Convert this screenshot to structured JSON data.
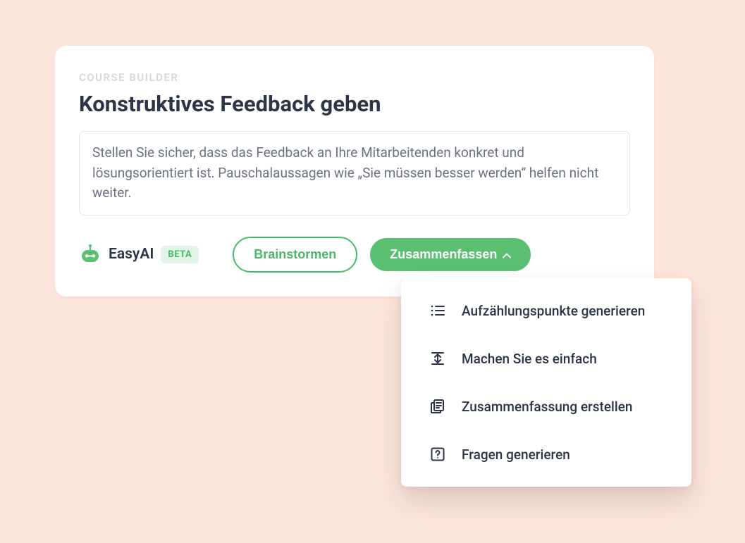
{
  "card": {
    "eyebrow": "COURSE BUILDER",
    "title": "Konstruktives Feedback geben",
    "textarea_value": "Stellen Sie sicher, dass das Feedback an Ihre Mitarbeitenden konkret und lösungsorientiert ist. Pauschalaussagen wie „Sie müssen besser werden“ helfen nicht weiter."
  },
  "toolbar": {
    "ai_label": "EasyAI",
    "beta_label": "BETA",
    "brainstorm_label": "Brainstormen",
    "summarize_label": "Zusammenfassen"
  },
  "dropdown": {
    "items": [
      {
        "label": "Aufzählungspunkte generieren"
      },
      {
        "label": "Machen Sie es einfach"
      },
      {
        "label": "Zusammenfassung erstellen"
      },
      {
        "label": "Fragen generieren"
      }
    ]
  },
  "colors": {
    "accent_green": "#5bbf71",
    "background": "#fde4db",
    "text_dark": "#2c3547"
  }
}
